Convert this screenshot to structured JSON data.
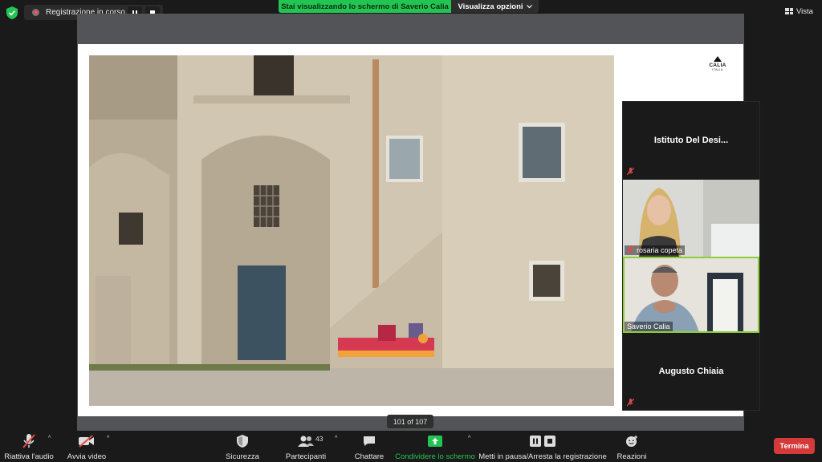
{
  "top_bar": {
    "recording_label": "Registrazione in corso...",
    "share_banner": "Stai visualizzando lo schermo di Saverio Calia",
    "view_options": "Visualizza opzioni",
    "view_label": "Vista"
  },
  "shared_slide": {
    "logo_name": "CALIA",
    "logo_sub": "ITALIA",
    "page_counter": "101 of 107"
  },
  "participants": {
    "tile1_name": "Istituto  Del  Desi...",
    "tile2_name": "rosaria copeta",
    "tile3_name": "Saverio Calia",
    "tile4_name": "Augusto Chiaia"
  },
  "toolbar": {
    "audio_label": "Riattiva l'audio",
    "video_label": "Avvia video",
    "security_label": "Sicurezza",
    "participants_label": "Partecipanti",
    "participants_count": "43",
    "chat_label": "Chattare",
    "share_label": "Condividere lo schermo",
    "record_label": "Metti in pausa/Arresta la registrazione",
    "reactions_label": "Reazioni",
    "end_label": "Termina"
  },
  "colors": {
    "share_green": "#23c552",
    "end_red": "#d43a3a",
    "active_speaker": "#8ccf3a"
  }
}
